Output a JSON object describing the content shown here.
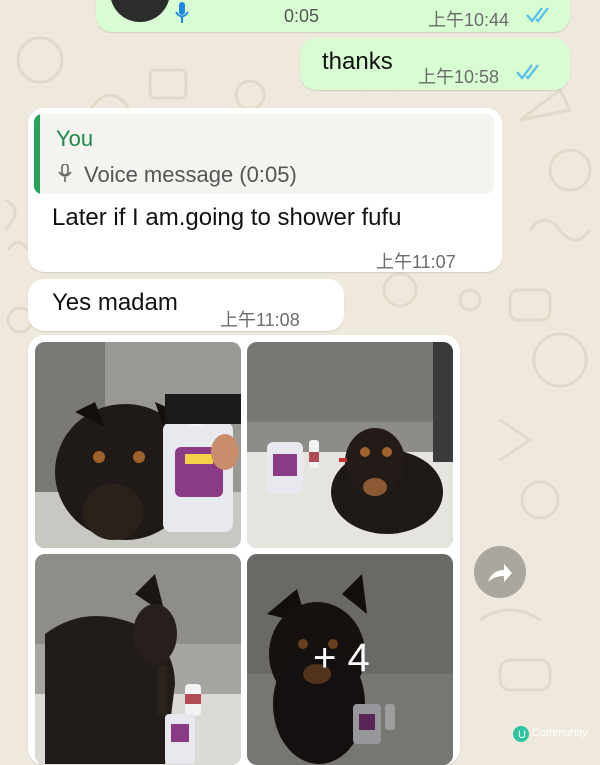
{
  "messages": {
    "voice_out": {
      "duration": "0:05",
      "time": "上午10:44"
    },
    "thanks": {
      "text": "thanks",
      "time": "上午10:58"
    },
    "reply": {
      "quote_author": "You",
      "quote_text": "Voice message (0:05)",
      "text": "Later if I am.going to shower fufu",
      "time": "上午11:07"
    },
    "yes": {
      "text": "Yes madam",
      "time": "上午11:08"
    },
    "album": {
      "more_count": "+ 4"
    }
  },
  "icons": {
    "mic": "mic-icon",
    "ticks": "double-check-icon",
    "forward": "forward-icon"
  },
  "colors": {
    "outgoing_bubble": "#d9fdd3",
    "incoming_bubble": "#ffffff",
    "quote_accent": "#25a35a",
    "read_ticks": "#53bdeb",
    "chat_background": "#efe8dc"
  },
  "watermark": {
    "text": "Community"
  }
}
